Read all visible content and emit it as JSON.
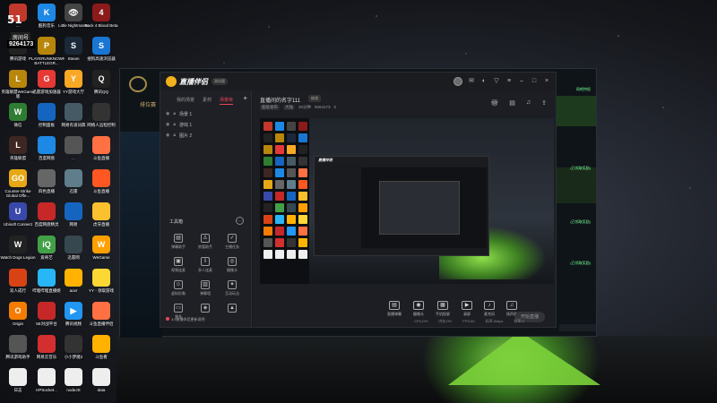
{
  "overlay": {
    "site_logo": "51",
    "room_label": "房间号",
    "room_number": "9264173"
  },
  "desktop": {
    "icons": [
      {
        "label": "...",
        "color": "#c0392b",
        "glyph": ""
      },
      {
        "label": "酷狗音乐",
        "color": "#1e88e5",
        "glyph": "K"
      },
      {
        "label": "Little Nightmares",
        "color": "#444",
        "glyph": "👁"
      },
      {
        "label": "Back 4 Blood Beta",
        "color": "#8b1a1a",
        "glyph": "4"
      },
      {
        "label": "腾讯游戏",
        "color": "#222",
        "glyph": ""
      },
      {
        "label": "PLAYERUNKNOWN'S BATTLEGR...",
        "color": "#b8860b",
        "glyph": "P"
      },
      {
        "label": "Steam",
        "color": "#1b2838",
        "glyph": "S"
      },
      {
        "label": "搜狗高速浏览器",
        "color": "#1976d2",
        "glyph": "S"
      },
      {
        "label": "英雄联盟WeGame版",
        "color": "#b8860b",
        "glyph": "L"
      },
      {
        "label": "迅雷游戏加速器",
        "color": "#e53935",
        "glyph": "G"
      },
      {
        "label": "YY游戏大厅",
        "color": "#f9a825",
        "glyph": "Y"
      },
      {
        "label": "腾讯QQ",
        "color": "#222",
        "glyph": "Q"
      },
      {
        "label": "微信",
        "color": "#2e7d32",
        "glyph": "W"
      },
      {
        "label": "控制面板",
        "color": "#1565c0",
        "glyph": ""
      },
      {
        "label": "网易有道词典",
        "color": "#455a64",
        "glyph": ""
      },
      {
        "label": "网络人远程控制",
        "color": "#333",
        "glyph": ""
      },
      {
        "label": "英雄联盟",
        "color": "#3e2723",
        "glyph": "L"
      },
      {
        "label": "百度网盘",
        "color": "#1e88e5",
        "glyph": ""
      },
      {
        "label": "...",
        "color": "#555",
        "glyph": ""
      },
      {
        "label": "斗鱼直播",
        "color": "#ff7043",
        "glyph": ""
      },
      {
        "label": "Counter-Strike Global Offe...",
        "color": "#e6a817",
        "glyph": "GO"
      },
      {
        "label": "四色直播",
        "color": "#666",
        "glyph": ""
      },
      {
        "label": "迅雷",
        "color": "#607d8b",
        "glyph": ""
      },
      {
        "label": "斗鱼直播",
        "color": "#ff5722",
        "glyph": ""
      },
      {
        "label": "Ubisoft Connect",
        "color": "#3949ab",
        "glyph": "U"
      },
      {
        "label": "百度网盘精灵",
        "color": "#c62828",
        "glyph": ""
      },
      {
        "label": "网易",
        "color": "#1565c0",
        "glyph": ""
      },
      {
        "label": "虎牙直播",
        "color": "#fbc02d",
        "glyph": ""
      },
      {
        "label": "Watch Dogs Legion",
        "color": "#222",
        "glyph": "W"
      },
      {
        "label": "爱奇艺",
        "color": "#43a047",
        "glyph": "iQ"
      },
      {
        "label": "迅雷网",
        "color": "#37474f",
        "glyph": ""
      },
      {
        "label": "WeGame",
        "color": "#ffa000",
        "glyph": "W"
      },
      {
        "label": "双人成行",
        "color": "#d84315",
        "glyph": ""
      },
      {
        "label": "哔哩哔哩直播姬",
        "color": "#29b6f6",
        "glyph": ""
      },
      {
        "label": "aovr",
        "color": "#ffb300",
        "glyph": ""
      },
      {
        "label": "YY - 领取游戏",
        "color": "#fdd835",
        "glyph": ""
      },
      {
        "label": "Origin",
        "color": "#f57c00",
        "glyph": "O"
      },
      {
        "label": "5E对战平台",
        "color": "#c62828",
        "glyph": ""
      },
      {
        "label": "腾讯视频",
        "color": "#2196f3",
        "glyph": "▶"
      },
      {
        "label": "斗鱼直播伴侣",
        "color": "#ff7043",
        "glyph": ""
      },
      {
        "label": "腾讯游戏助手",
        "color": "#555",
        "glyph": ""
      },
      {
        "label": "网易云音乐",
        "color": "#d32f2f",
        "glyph": ""
      },
      {
        "label": "小小梦魇2",
        "color": "#333",
        "glyph": ""
      },
      {
        "label": "斗鱼看",
        "color": "#ffb300",
        "glyph": ""
      },
      {
        "label": "日志",
        "color": "#eee",
        "glyph": ""
      },
      {
        "label": "HPSocket...",
        "color": "#eee",
        "glyph": ""
      },
      {
        "label": "nodeJS",
        "color": "#eee",
        "glyph": ""
      },
      {
        "label": "data",
        "color": "#eee",
        "glyph": ""
      }
    ]
  },
  "lol_client": {
    "title": "排位赛",
    "right_texts": [
      "网吧特权",
      "(已领取奖励)",
      "(已领取奖励)",
      "(已领取奖励)"
    ]
  },
  "app": {
    "name": "直播伴侣",
    "version": "测试版",
    "left_tabs": [
      "我的场景",
      "素材",
      "场景库"
    ],
    "active_tab": 2,
    "scenes": [
      {
        "name": "场景 1"
      },
      {
        "name": "游戏 1"
      },
      {
        "name": "图片 2"
      }
    ],
    "tools_label": "工具箱",
    "tools": [
      {
        "label": "弹幕助手",
        "glyph": "▤"
      },
      {
        "label": "房管助手",
        "glyph": "♙"
      },
      {
        "label": "主播任务",
        "glyph": "✓"
      },
      {
        "label": "视频连麦",
        "glyph": "▣"
      },
      {
        "label": "多人连麦",
        "glyph": "⇩"
      },
      {
        "label": "摄像头",
        "glyph": "◎"
      },
      {
        "label": "虚拟形象",
        "glyph": "☺"
      },
      {
        "label": "弹幕墙",
        "glyph": "▥"
      },
      {
        "label": "互动玩法",
        "glyph": "✦"
      },
      {
        "label": "更多",
        "glyph": "▭"
      },
      {
        "label": "",
        "glyph": "◈"
      },
      {
        "label": "",
        "glyph": "▲"
      }
    ],
    "notice": "3.6直播伴侣更新说明",
    "room_title": "直播间的名字111",
    "edit_label": "修改",
    "info": [
      "超级发布",
      "大陆",
      "30分钟",
      "9264173",
      "0"
    ],
    "controls": [
      {
        "label": "直播弹幕",
        "glyph": "▤"
      },
      {
        "label": "摄像头",
        "glyph": "◉"
      },
      {
        "label": "手机投屏",
        "glyph": "▦"
      },
      {
        "label": "录屏",
        "glyph": "▶"
      },
      {
        "label": "麦克风",
        "glyph": "♪"
      },
      {
        "label": "扬声器",
        "glyph": "♫"
      }
    ],
    "start_label": "开始直播",
    "status": [
      "CPU:0%",
      "内存:0%",
      "FPS:60",
      "码率:0kbps",
      "帧率:0"
    ]
  }
}
